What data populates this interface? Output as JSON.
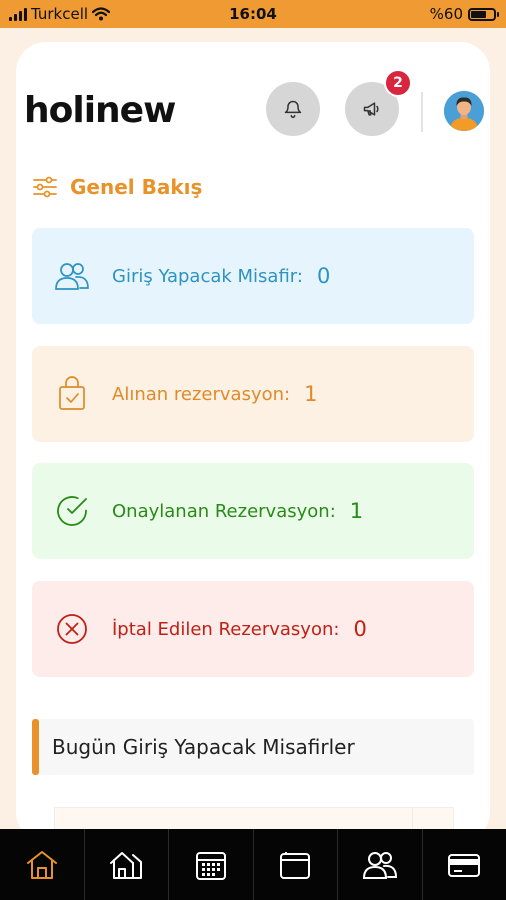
{
  "status_bar": {
    "carrier": "Turkcell",
    "time": "16:04",
    "battery": "%60"
  },
  "app": {
    "logo_text": "holinew"
  },
  "header": {
    "notifications_badge": "2"
  },
  "overview": {
    "title": "Genel Bakış"
  },
  "stats": [
    {
      "label": "Giriş Yapacak Misafir:",
      "value": "0",
      "icon": "users-icon",
      "color": "#2e93c3"
    },
    {
      "label": "Alınan rezervasyon:",
      "value": "1",
      "icon": "shopping-bag-check-icon",
      "color": "#e08a2a"
    },
    {
      "label": "Onaylanan Rezervasyon:",
      "value": "1",
      "icon": "check-circle-icon",
      "color": "#2a8a18"
    },
    {
      "label": "İptal Edilen Rezervasyon:",
      "value": "0",
      "icon": "x-circle-icon",
      "color": "#c02016"
    }
  ],
  "today_section": {
    "title": "Bugün Giriş Yapacak Misafirler"
  },
  "tab_bar": {
    "active_color": "#e8922a",
    "items": [
      "home-icon",
      "building-icon",
      "calendar-icon",
      "wallet-icon",
      "users-icon",
      "credit-card-icon"
    ]
  }
}
